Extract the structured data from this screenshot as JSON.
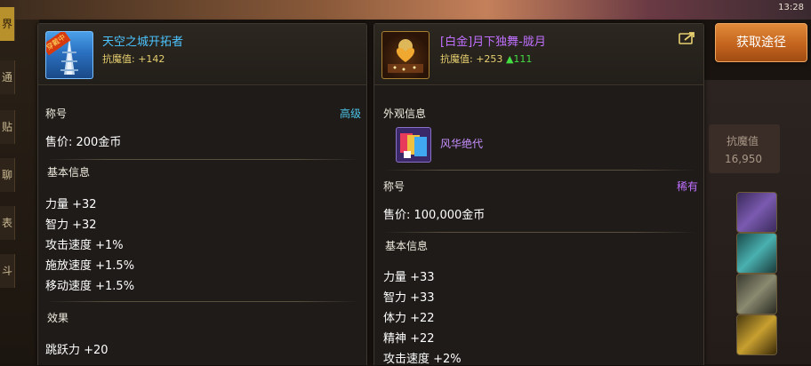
{
  "bg": {
    "clock": "13:28",
    "left_tabs": [
      "界",
      "通",
      "贴",
      "聊",
      "表",
      "斗"
    ],
    "right_stat_label": "抗魔值",
    "right_stat_value": "16,950"
  },
  "panel_a": {
    "badge": "穿戴中",
    "name": "天空之城开拓者",
    "stat_label": "抗魔值:",
    "stat_value": "+142",
    "category_label": "称号",
    "grade": "高级",
    "price": "售价: 200金币",
    "basic_title": "基本信息",
    "basic_stats": [
      "力量 +32",
      "智力 +32",
      "攻击速度 +1%",
      "施放速度 +1.5%",
      "移动速度 +1.5%"
    ],
    "effect_title": "效果",
    "effects": [
      "跳跃力 +20"
    ]
  },
  "panel_b": {
    "name": "[白金]月下独舞-胧月",
    "stat_label": "抗魔值:",
    "stat_value": "+253",
    "stat_delta": "▲111",
    "appearance_title": "外观信息",
    "appearance_name": "风华绝代",
    "category_label": "称号",
    "grade": "稀有",
    "price": "售价: 100,000金币",
    "basic_title": "基本信息",
    "basic_stats": [
      "力量 +33",
      "智力 +33",
      "体力 +22",
      "精神 +22",
      "攻击速度 +2%"
    ]
  },
  "acquire_button": "获取途径",
  "colors": {
    "name_blue": "#4cc4ff",
    "name_purple": "#c070ff",
    "grade_high": "#4cc4e8",
    "grade_rare": "#c070ff",
    "stat_gold": "#e8d070",
    "delta_green": "#44dd44",
    "button_orange": "#c4641e"
  }
}
